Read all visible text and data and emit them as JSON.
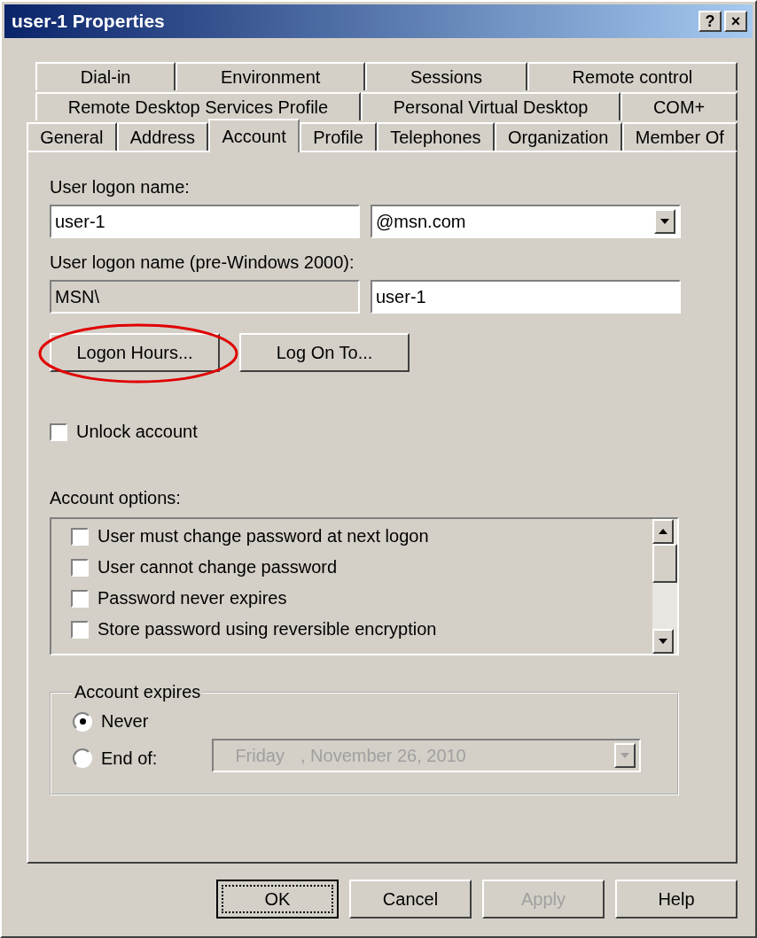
{
  "window": {
    "title": "user-1 Properties",
    "help_button": "?",
    "close_button": "×"
  },
  "tab_rows": [
    [
      {
        "label": "Dial-in",
        "selected": false
      },
      {
        "label": "Environment",
        "selected": false
      },
      {
        "label": "Sessions",
        "selected": false
      },
      {
        "label": "Remote control",
        "selected": false
      }
    ],
    [
      {
        "label": "Remote Desktop Services Profile",
        "selected": false
      },
      {
        "label": "Personal Virtual Desktop",
        "selected": false
      },
      {
        "label": "COM+",
        "selected": false
      }
    ],
    [
      {
        "label": "General",
        "selected": false
      },
      {
        "label": "Address",
        "selected": false
      },
      {
        "label": "Account",
        "selected": true
      },
      {
        "label": "Profile",
        "selected": false
      },
      {
        "label": "Telephones",
        "selected": false
      },
      {
        "label": "Organization",
        "selected": false
      },
      {
        "label": "Member Of",
        "selected": false
      }
    ]
  ],
  "logon_name": {
    "label": "User logon name:",
    "value": "user-1",
    "domain": "@msn.com"
  },
  "pre_windows_2000": {
    "label": "User logon name (pre-Windows 2000):",
    "domain": "MSN\\",
    "value": "user-1"
  },
  "action_buttons": [
    {
      "label": "Logon Hours...",
      "highlighted": true
    },
    {
      "label": "Log On To...",
      "highlighted": false
    }
  ],
  "unlock_account": {
    "label": "Unlock account",
    "checked": false
  },
  "account_options": {
    "label": "Account options:",
    "items": [
      {
        "label": "User must change password at next logon",
        "checked": false
      },
      {
        "label": "User cannot change password",
        "checked": false
      },
      {
        "label": "Password never expires",
        "checked": false
      },
      {
        "label": "Store password using reversible encryption",
        "checked": false
      }
    ]
  },
  "account_expires": {
    "title": "Account expires",
    "options": [
      {
        "label": "Never",
        "selected": true
      },
      {
        "label": "End of:",
        "selected": false
      }
    ],
    "date": {
      "day": "Friday",
      "date": ", November 26, 2010",
      "disabled": true
    }
  },
  "footer_buttons": [
    {
      "label": "OK",
      "default": true,
      "disabled": false
    },
    {
      "label": "Cancel",
      "default": false,
      "disabled": false
    },
    {
      "label": "Apply",
      "default": false,
      "disabled": true
    },
    {
      "label": "Help",
      "default": false,
      "disabled": false
    }
  ]
}
